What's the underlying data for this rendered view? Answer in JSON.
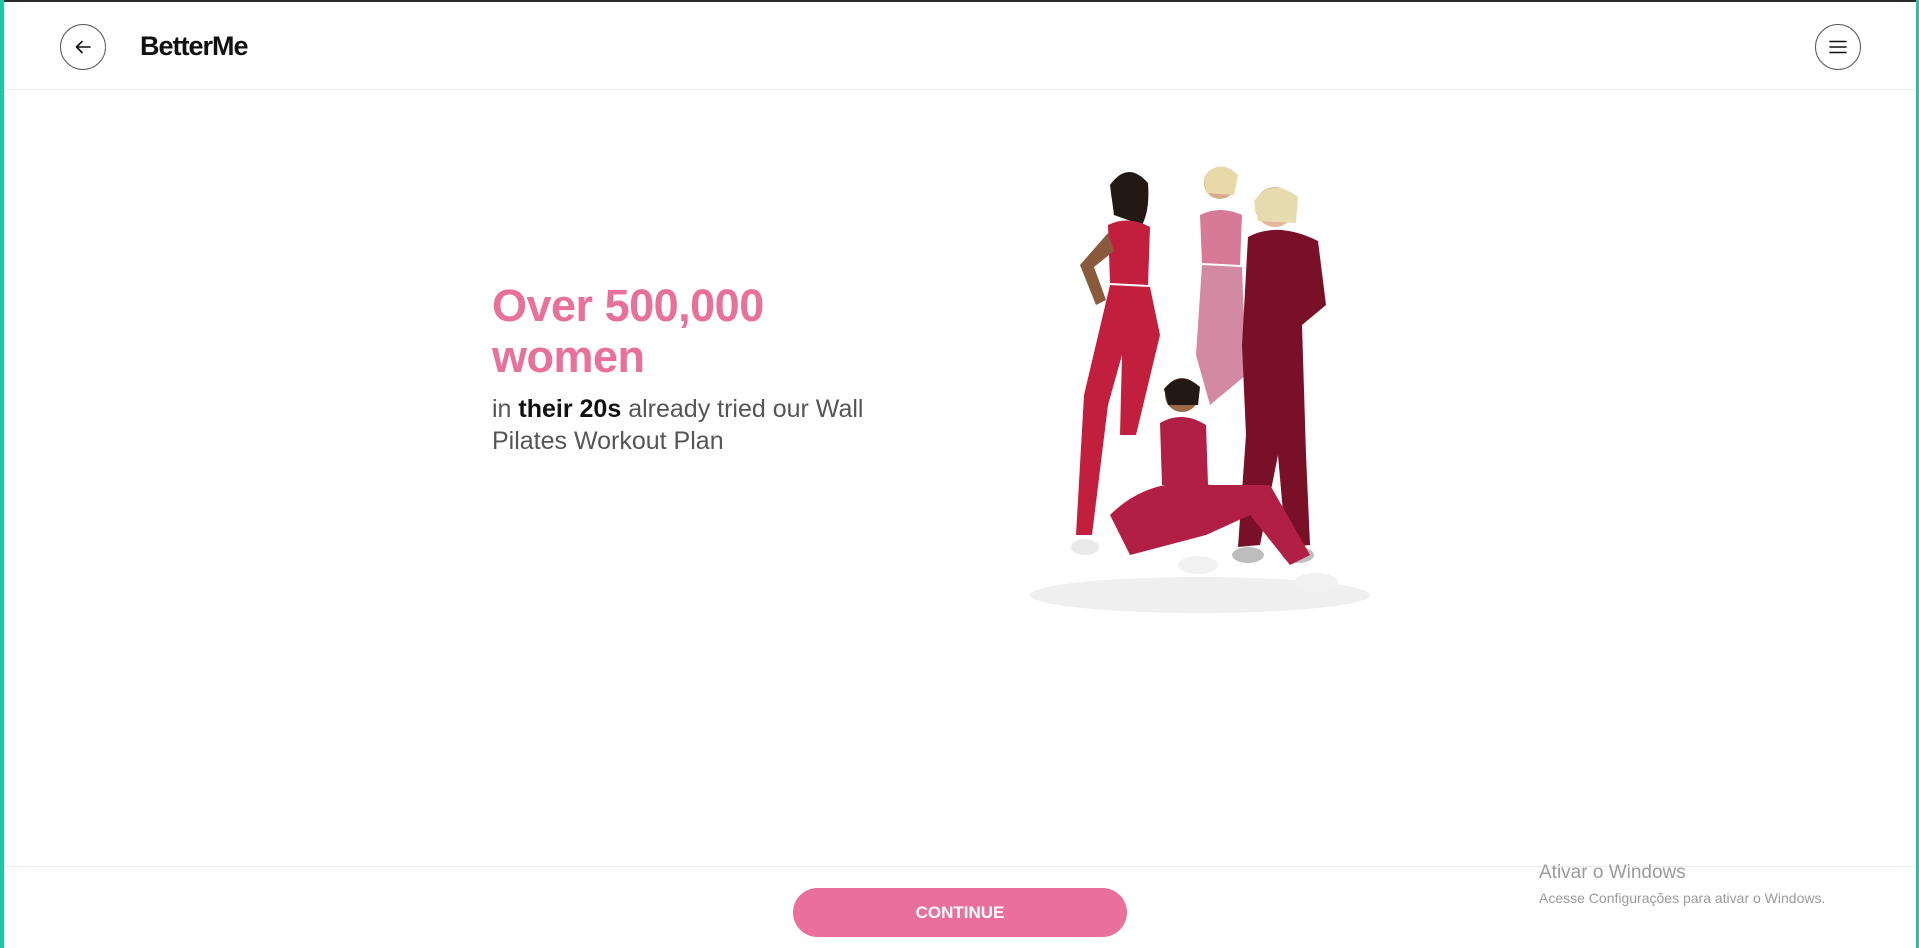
{
  "header": {
    "logo": "BetterMe",
    "back_icon": "arrow-left-icon",
    "menu_icon": "hamburger-menu-icon"
  },
  "main": {
    "headline": "Over 500,000 women",
    "sub_prefix": "in ",
    "sub_bold": "their 20s",
    "sub_suffix": " already tried our Wall Pilates Workout Plan"
  },
  "footer": {
    "continue_label": "CONTINUE"
  },
  "watermark": {
    "title": "Ativar o Windows",
    "subtitle": "Acesse Configurações para ativar o Windows."
  },
  "colors": {
    "accent": "#e8709a",
    "frame": "#1fc8a0"
  }
}
